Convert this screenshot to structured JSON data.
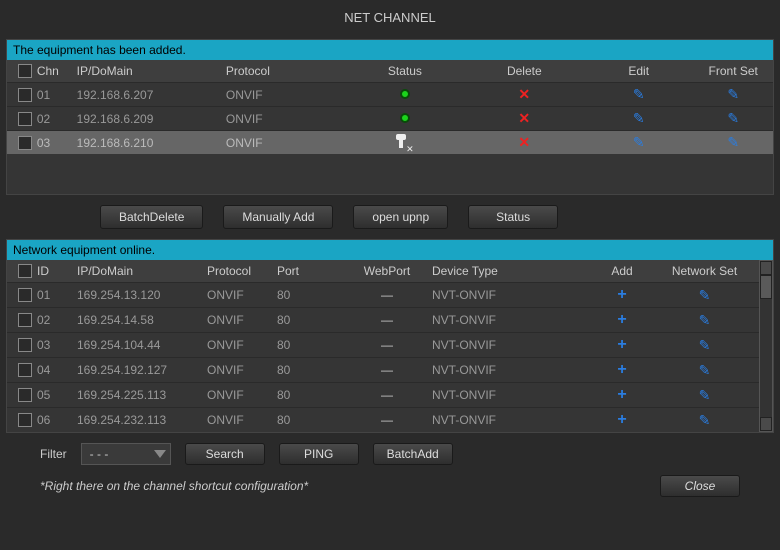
{
  "title": "NET CHANNEL",
  "added_header": "The equipment has been added.",
  "online_header": "Network equipment online.",
  "columns_top": {
    "chn": "Chn",
    "ip": "IP/DoMain",
    "protocol": "Protocol",
    "status": "Status",
    "delete": "Delete",
    "edit": "Edit",
    "front": "Front Set"
  },
  "columns_bottom": {
    "id": "ID",
    "ip": "IP/DoMain",
    "protocol": "Protocol",
    "port": "Port",
    "webport": "WebPort",
    "device": "Device Type",
    "add": "Add",
    "netset": "Network Set"
  },
  "top_rows": [
    {
      "chn": "01",
      "ip": "192.168.6.207",
      "protocol": "ONVIF",
      "status": "ok"
    },
    {
      "chn": "02",
      "ip": "192.168.6.209",
      "protocol": "ONVIF",
      "status": "ok"
    },
    {
      "chn": "03",
      "ip": "192.168.6.210",
      "protocol": "ONVIF",
      "status": "offline",
      "selected": true
    }
  ],
  "mid_buttons": {
    "batch_delete": "BatchDelete",
    "manually_add": "Manually Add",
    "open_upnp": "open upnp",
    "status": "Status"
  },
  "bottom_rows": [
    {
      "id": "01",
      "ip": "169.254.13.120",
      "protocol": "ONVIF",
      "port": "80",
      "web": "—",
      "device": "NVT-ONVIF"
    },
    {
      "id": "02",
      "ip": "169.254.14.58",
      "protocol": "ONVIF",
      "port": "80",
      "web": "—",
      "device": "NVT-ONVIF"
    },
    {
      "id": "03",
      "ip": "169.254.104.44",
      "protocol": "ONVIF",
      "port": "80",
      "web": "—",
      "device": "NVT-ONVIF"
    },
    {
      "id": "04",
      "ip": "169.254.192.127",
      "protocol": "ONVIF",
      "port": "80",
      "web": "—",
      "device": "NVT-ONVIF"
    },
    {
      "id": "05",
      "ip": "169.254.225.113",
      "protocol": "ONVIF",
      "port": "80",
      "web": "—",
      "device": "NVT-ONVIF"
    },
    {
      "id": "06",
      "ip": "169.254.232.113",
      "protocol": "ONVIF",
      "port": "80",
      "web": "—",
      "device": "NVT-ONVIF"
    }
  ],
  "filter": {
    "label": "Filter",
    "selected": "- - -",
    "search": "Search",
    "ping": "PING",
    "batch_add": "BatchAdd"
  },
  "hint": "*Right there on the channel shortcut configuration*",
  "close": "Close"
}
